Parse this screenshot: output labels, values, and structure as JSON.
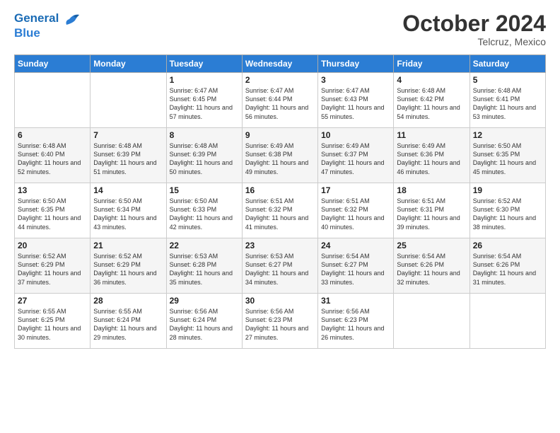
{
  "header": {
    "logo_text1": "General",
    "logo_text2": "Blue",
    "month": "October 2024",
    "location": "Telcruz, Mexico"
  },
  "days_of_week": [
    "Sunday",
    "Monday",
    "Tuesday",
    "Wednesday",
    "Thursday",
    "Friday",
    "Saturday"
  ],
  "weeks": [
    [
      {
        "day": "",
        "content": ""
      },
      {
        "day": "",
        "content": ""
      },
      {
        "day": "1",
        "content": "Sunrise: 6:47 AM\nSunset: 6:45 PM\nDaylight: 11 hours and 57 minutes."
      },
      {
        "day": "2",
        "content": "Sunrise: 6:47 AM\nSunset: 6:44 PM\nDaylight: 11 hours and 56 minutes."
      },
      {
        "day": "3",
        "content": "Sunrise: 6:47 AM\nSunset: 6:43 PM\nDaylight: 11 hours and 55 minutes."
      },
      {
        "day": "4",
        "content": "Sunrise: 6:48 AM\nSunset: 6:42 PM\nDaylight: 11 hours and 54 minutes."
      },
      {
        "day": "5",
        "content": "Sunrise: 6:48 AM\nSunset: 6:41 PM\nDaylight: 11 hours and 53 minutes."
      }
    ],
    [
      {
        "day": "6",
        "content": "Sunrise: 6:48 AM\nSunset: 6:40 PM\nDaylight: 11 hours and 52 minutes."
      },
      {
        "day": "7",
        "content": "Sunrise: 6:48 AM\nSunset: 6:39 PM\nDaylight: 11 hours and 51 minutes."
      },
      {
        "day": "8",
        "content": "Sunrise: 6:48 AM\nSunset: 6:39 PM\nDaylight: 11 hours and 50 minutes."
      },
      {
        "day": "9",
        "content": "Sunrise: 6:49 AM\nSunset: 6:38 PM\nDaylight: 11 hours and 49 minutes."
      },
      {
        "day": "10",
        "content": "Sunrise: 6:49 AM\nSunset: 6:37 PM\nDaylight: 11 hours and 47 minutes."
      },
      {
        "day": "11",
        "content": "Sunrise: 6:49 AM\nSunset: 6:36 PM\nDaylight: 11 hours and 46 minutes."
      },
      {
        "day": "12",
        "content": "Sunrise: 6:50 AM\nSunset: 6:35 PM\nDaylight: 11 hours and 45 minutes."
      }
    ],
    [
      {
        "day": "13",
        "content": "Sunrise: 6:50 AM\nSunset: 6:35 PM\nDaylight: 11 hours and 44 minutes."
      },
      {
        "day": "14",
        "content": "Sunrise: 6:50 AM\nSunset: 6:34 PM\nDaylight: 11 hours and 43 minutes."
      },
      {
        "day": "15",
        "content": "Sunrise: 6:50 AM\nSunset: 6:33 PM\nDaylight: 11 hours and 42 minutes."
      },
      {
        "day": "16",
        "content": "Sunrise: 6:51 AM\nSunset: 6:32 PM\nDaylight: 11 hours and 41 minutes."
      },
      {
        "day": "17",
        "content": "Sunrise: 6:51 AM\nSunset: 6:32 PM\nDaylight: 11 hours and 40 minutes."
      },
      {
        "day": "18",
        "content": "Sunrise: 6:51 AM\nSunset: 6:31 PM\nDaylight: 11 hours and 39 minutes."
      },
      {
        "day": "19",
        "content": "Sunrise: 6:52 AM\nSunset: 6:30 PM\nDaylight: 11 hours and 38 minutes."
      }
    ],
    [
      {
        "day": "20",
        "content": "Sunrise: 6:52 AM\nSunset: 6:29 PM\nDaylight: 11 hours and 37 minutes."
      },
      {
        "day": "21",
        "content": "Sunrise: 6:52 AM\nSunset: 6:29 PM\nDaylight: 11 hours and 36 minutes."
      },
      {
        "day": "22",
        "content": "Sunrise: 6:53 AM\nSunset: 6:28 PM\nDaylight: 11 hours and 35 minutes."
      },
      {
        "day": "23",
        "content": "Sunrise: 6:53 AM\nSunset: 6:27 PM\nDaylight: 11 hours and 34 minutes."
      },
      {
        "day": "24",
        "content": "Sunrise: 6:54 AM\nSunset: 6:27 PM\nDaylight: 11 hours and 33 minutes."
      },
      {
        "day": "25",
        "content": "Sunrise: 6:54 AM\nSunset: 6:26 PM\nDaylight: 11 hours and 32 minutes."
      },
      {
        "day": "26",
        "content": "Sunrise: 6:54 AM\nSunset: 6:26 PM\nDaylight: 11 hours and 31 minutes."
      }
    ],
    [
      {
        "day": "27",
        "content": "Sunrise: 6:55 AM\nSunset: 6:25 PM\nDaylight: 11 hours and 30 minutes."
      },
      {
        "day": "28",
        "content": "Sunrise: 6:55 AM\nSunset: 6:24 PM\nDaylight: 11 hours and 29 minutes."
      },
      {
        "day": "29",
        "content": "Sunrise: 6:56 AM\nSunset: 6:24 PM\nDaylight: 11 hours and 28 minutes."
      },
      {
        "day": "30",
        "content": "Sunrise: 6:56 AM\nSunset: 6:23 PM\nDaylight: 11 hours and 27 minutes."
      },
      {
        "day": "31",
        "content": "Sunrise: 6:56 AM\nSunset: 6:23 PM\nDaylight: 11 hours and 26 minutes."
      },
      {
        "day": "",
        "content": ""
      },
      {
        "day": "",
        "content": ""
      }
    ]
  ]
}
